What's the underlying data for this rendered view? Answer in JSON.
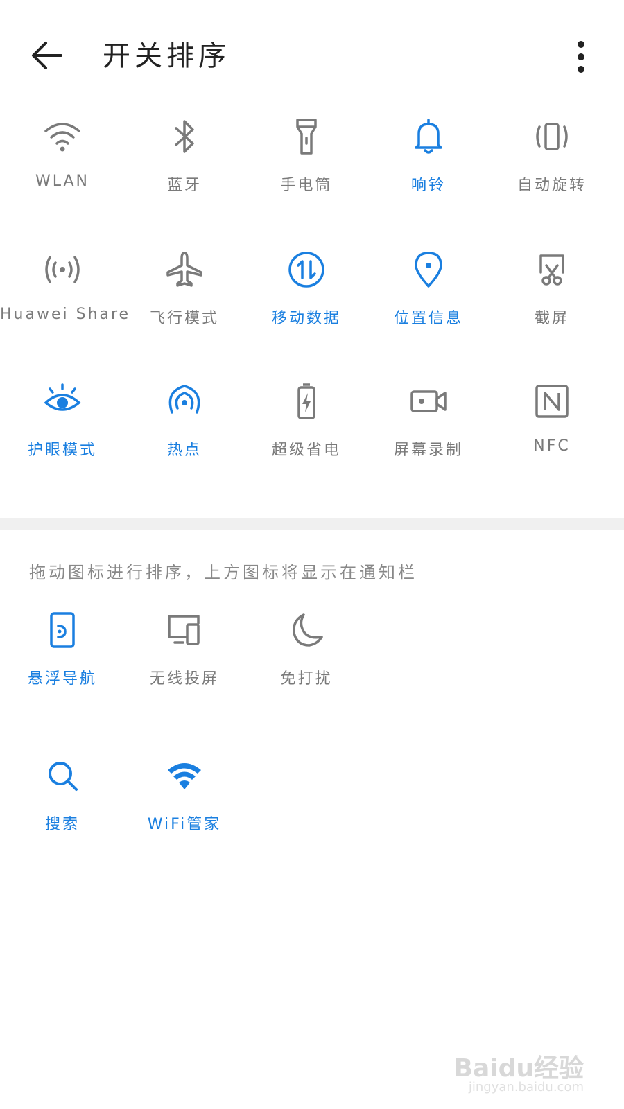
{
  "header": {
    "title": "开关排序",
    "back_icon": "arrow-left-icon",
    "more_icon": "more-vertical-icon"
  },
  "colors": {
    "active": "#1a7fe0",
    "inactive": "#7a7a7a",
    "divider": "#f0f0f0"
  },
  "active_tiles": [
    {
      "label": "WLAN",
      "icon": "wifi-icon",
      "state": "off"
    },
    {
      "label": "蓝牙",
      "icon": "bluetooth-icon",
      "state": "off"
    },
    {
      "label": "手电筒",
      "icon": "flashlight-icon",
      "state": "off"
    },
    {
      "label": "响铃",
      "icon": "bell-icon",
      "state": "on"
    },
    {
      "label": "自动旋转",
      "icon": "auto-rotate-icon",
      "state": "off"
    },
    {
      "label": "Huawei Share",
      "icon": "huawei-share-icon",
      "state": "off"
    },
    {
      "label": "飞行模式",
      "icon": "airplane-icon",
      "state": "off"
    },
    {
      "label": "移动数据",
      "icon": "mobile-data-icon",
      "state": "on"
    },
    {
      "label": "位置信息",
      "icon": "location-icon",
      "state": "on"
    },
    {
      "label": "截屏",
      "icon": "screenshot-icon",
      "state": "off"
    },
    {
      "label": "护眼模式",
      "icon": "eye-comfort-icon",
      "state": "on"
    },
    {
      "label": "热点",
      "icon": "hotspot-icon",
      "state": "on"
    },
    {
      "label": "超级省电",
      "icon": "battery-saver-icon",
      "state": "off"
    },
    {
      "label": "屏幕录制",
      "icon": "screen-record-icon",
      "state": "off"
    },
    {
      "label": "NFC",
      "icon": "nfc-icon",
      "state": "off"
    }
  ],
  "hint": "拖动图标进行排序，上方图标将显示在通知栏",
  "inactive_tiles": [
    {
      "label": "悬浮导航",
      "icon": "floating-nav-icon",
      "state": "on"
    },
    {
      "label": "无线投屏",
      "icon": "wireless-projection-icon",
      "state": "off"
    },
    {
      "label": "免打扰",
      "icon": "moon-icon",
      "state": "off"
    },
    {
      "label": "搜索",
      "icon": "search-icon",
      "state": "on"
    },
    {
      "label": "WiFi管家",
      "icon": "wifi-manager-icon",
      "state": "on"
    }
  ],
  "watermark": {
    "main": "Baidu经验",
    "sub": "jingyan.baidu.com"
  }
}
